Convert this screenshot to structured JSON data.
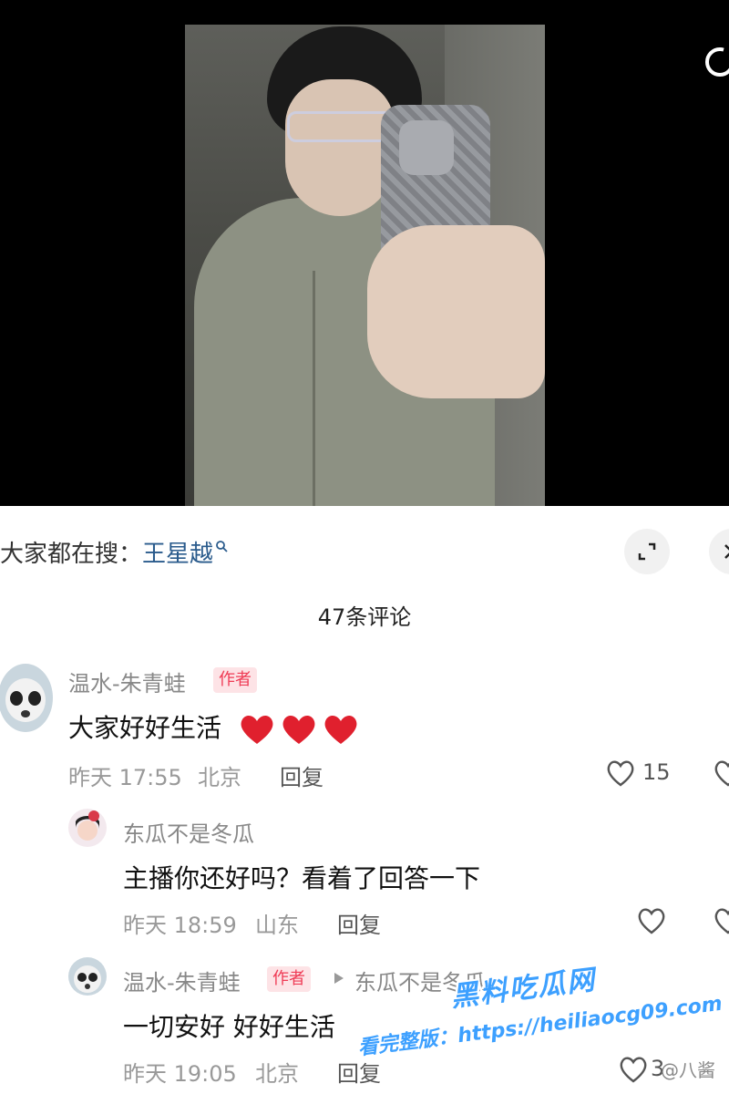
{
  "search": {
    "prefix": "大家都在搜：",
    "keyword": "王星越"
  },
  "comments_header": {
    "count_label": "47条评论"
  },
  "comments": [
    {
      "author": "温水-朱青蛙",
      "tag": "作者",
      "text": "大家好好生活",
      "time": "昨天 17:55",
      "location": "北京",
      "reply_label": "回复",
      "likes": "15"
    },
    {
      "author": "东瓜不是冬瓜",
      "text": "主播你还好吗？看着了回答一下",
      "time": "昨天 18:59",
      "location": "山东",
      "reply_label": "回复"
    },
    {
      "author": "温水-朱青蛙",
      "tag": "作者",
      "reply_to": "东瓜不是冬瓜",
      "text": "一切安好 好好生活",
      "time": "昨天 19:05",
      "location": "北京",
      "reply_label": "回复",
      "likes": "3"
    }
  ],
  "watermark": {
    "title": "黑料吃瓜网",
    "url": "看完整版：https://heiliaocg09.com"
  },
  "credit": "@八酱",
  "colors": {
    "accent_red": "#ef3b55",
    "link_blue": "#2a5b8c",
    "watermark_blue": "#3da0ff"
  }
}
